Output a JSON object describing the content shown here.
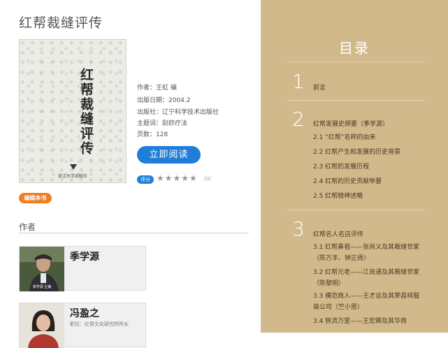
{
  "book": {
    "title": "红帮裁缝评传",
    "cover_title": "红帮裁缝评传",
    "cover_publisher": "浙江大学出版社",
    "author_line": "作者：王虹 编",
    "date_line": "出版日期：2004.2",
    "publisher_line": "出版社：辽宁科学技术出版社",
    "subject_line": "主题词：刮痧疗法",
    "pages_line": "页数：128"
  },
  "actions": {
    "read_label": "立即阅读",
    "edit_label": "编辑本书"
  },
  "rating": {
    "label": "评分",
    "stars": "★★★★★",
    "count": "(0)"
  },
  "authors_section": {
    "title": "作者",
    "authors": [
      {
        "name": "季学源",
        "caption": "季学源 主编",
        "role": ""
      },
      {
        "name": "冯盈之",
        "caption": "",
        "role": "职位：红帮文化研究所所长"
      }
    ]
  },
  "toc": {
    "title": "目录",
    "chapters": [
      {
        "num": "1",
        "title": "前言",
        "items": []
      },
      {
        "num": "2",
        "title": "红帮发展史纲要（季学源）",
        "items": [
          "2.1 “红帮”名称的由来",
          "2.2 红帮产生和发展的历史背景",
          "2.3 红帮的发展历程",
          "2.4 红帮的历史贡献举要",
          "2.5 红帮精神述略"
        ]
      },
      {
        "num": "3",
        "title": "红帮名人名店评传",
        "items": [
          "3.1 红帮鼻祖——张尚义及其裁缝世家（陈万丰、钟正扬）",
          "3.2 红帮元老——江良通及其裁缝世家（陈黎明）",
          "3.3 横范商人——王才运及其荣昌祥服装公司（竺小恩）",
          "3.4 铁流万里——王宏卿及其华商"
        ]
      }
    ]
  },
  "colors": {
    "toc_bg": "#d2b98c",
    "primary_blue": "#1f7fd8",
    "orange": "#f07e1f"
  }
}
